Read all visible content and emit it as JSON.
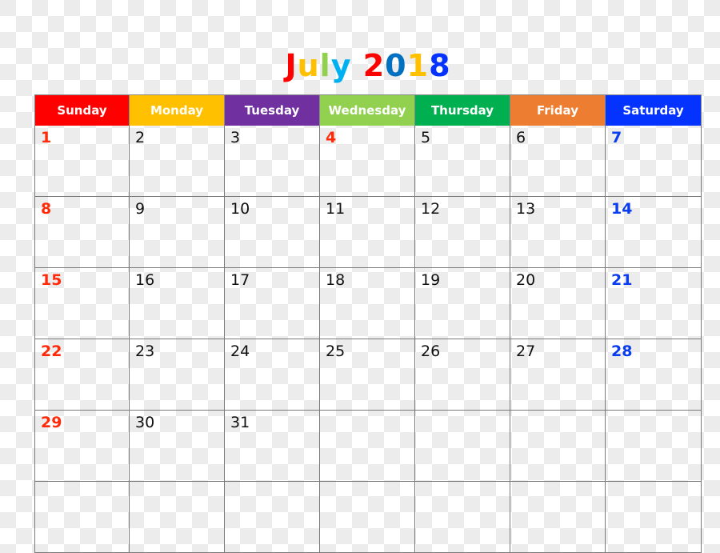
{
  "title": {
    "text": "July 2018",
    "letters": [
      {
        "char": "J",
        "color": "#ff0000"
      },
      {
        "char": "u",
        "color": "#ffc000"
      },
      {
        "char": "l",
        "color": "#92d050"
      },
      {
        "char": "y",
        "color": "#00b0f0"
      },
      {
        "char": " ",
        "color": "#000000"
      },
      {
        "char": "2",
        "color": "#ff0000"
      },
      {
        "char": "0",
        "color": "#0070c0"
      },
      {
        "char": "1",
        "color": "#ffc000"
      },
      {
        "char": "8",
        "color": "#0432ff"
      }
    ]
  },
  "weekdays": [
    {
      "label": "Sunday",
      "color": "#ff0000"
    },
    {
      "label": "Monday",
      "color": "#ffc000"
    },
    {
      "label": "Tuesday",
      "color": "#7030a0"
    },
    {
      "label": "Wednesday",
      "color": "#92d050"
    },
    {
      "label": "Thursday",
      "color": "#00b050"
    },
    {
      "label": "Friday",
      "color": "#ed7d31"
    },
    {
      "label": "Saturday",
      "color": "#0432ff"
    }
  ],
  "weeks": [
    [
      {
        "day": "1",
        "type": "sun"
      },
      {
        "day": "2"
      },
      {
        "day": "3"
      },
      {
        "day": "4",
        "type": "holiday"
      },
      {
        "day": "5"
      },
      {
        "day": "6"
      },
      {
        "day": "7",
        "type": "sat"
      }
    ],
    [
      {
        "day": "8",
        "type": "sun"
      },
      {
        "day": "9"
      },
      {
        "day": "10"
      },
      {
        "day": "11"
      },
      {
        "day": "12"
      },
      {
        "day": "13"
      },
      {
        "day": "14",
        "type": "sat"
      }
    ],
    [
      {
        "day": "15",
        "type": "sun"
      },
      {
        "day": "16"
      },
      {
        "day": "17"
      },
      {
        "day": "18"
      },
      {
        "day": "19"
      },
      {
        "day": "20"
      },
      {
        "day": "21",
        "type": "sat"
      }
    ],
    [
      {
        "day": "22",
        "type": "sun"
      },
      {
        "day": "23"
      },
      {
        "day": "24"
      },
      {
        "day": "25"
      },
      {
        "day": "26"
      },
      {
        "day": "27"
      },
      {
        "day": "28",
        "type": "sat"
      }
    ],
    [
      {
        "day": "29",
        "type": "sun"
      },
      {
        "day": "30"
      },
      {
        "day": "31"
      },
      {
        "day": ""
      },
      {
        "day": ""
      },
      {
        "day": ""
      },
      {
        "day": ""
      }
    ],
    [
      {
        "day": ""
      },
      {
        "day": ""
      },
      {
        "day": ""
      },
      {
        "day": ""
      },
      {
        "day": ""
      },
      {
        "day": ""
      },
      {
        "day": ""
      }
    ]
  ]
}
